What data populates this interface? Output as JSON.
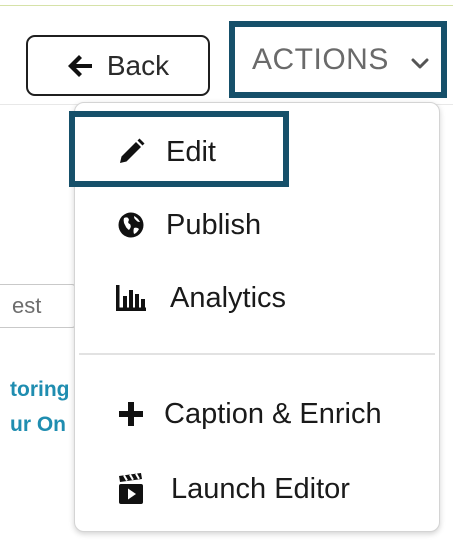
{
  "header": {
    "back_label": "Back",
    "actions_label": "ACTIONS"
  },
  "menu": {
    "items": [
      {
        "label": "Edit",
        "icon": "pencil-icon"
      },
      {
        "label": "Publish",
        "icon": "globe-icon"
      },
      {
        "label": "Analytics",
        "icon": "bar-chart-icon"
      },
      {
        "label": "Caption & Enrich",
        "icon": "plus-icon"
      },
      {
        "label": "Launch Editor",
        "icon": "clapperboard-icon"
      }
    ]
  },
  "background": {
    "input_value": "est",
    "link_line_1": "toring",
    "link_line_2": "ur On"
  },
  "colors": {
    "highlight": "#16506a",
    "link": "#1f8db0"
  }
}
